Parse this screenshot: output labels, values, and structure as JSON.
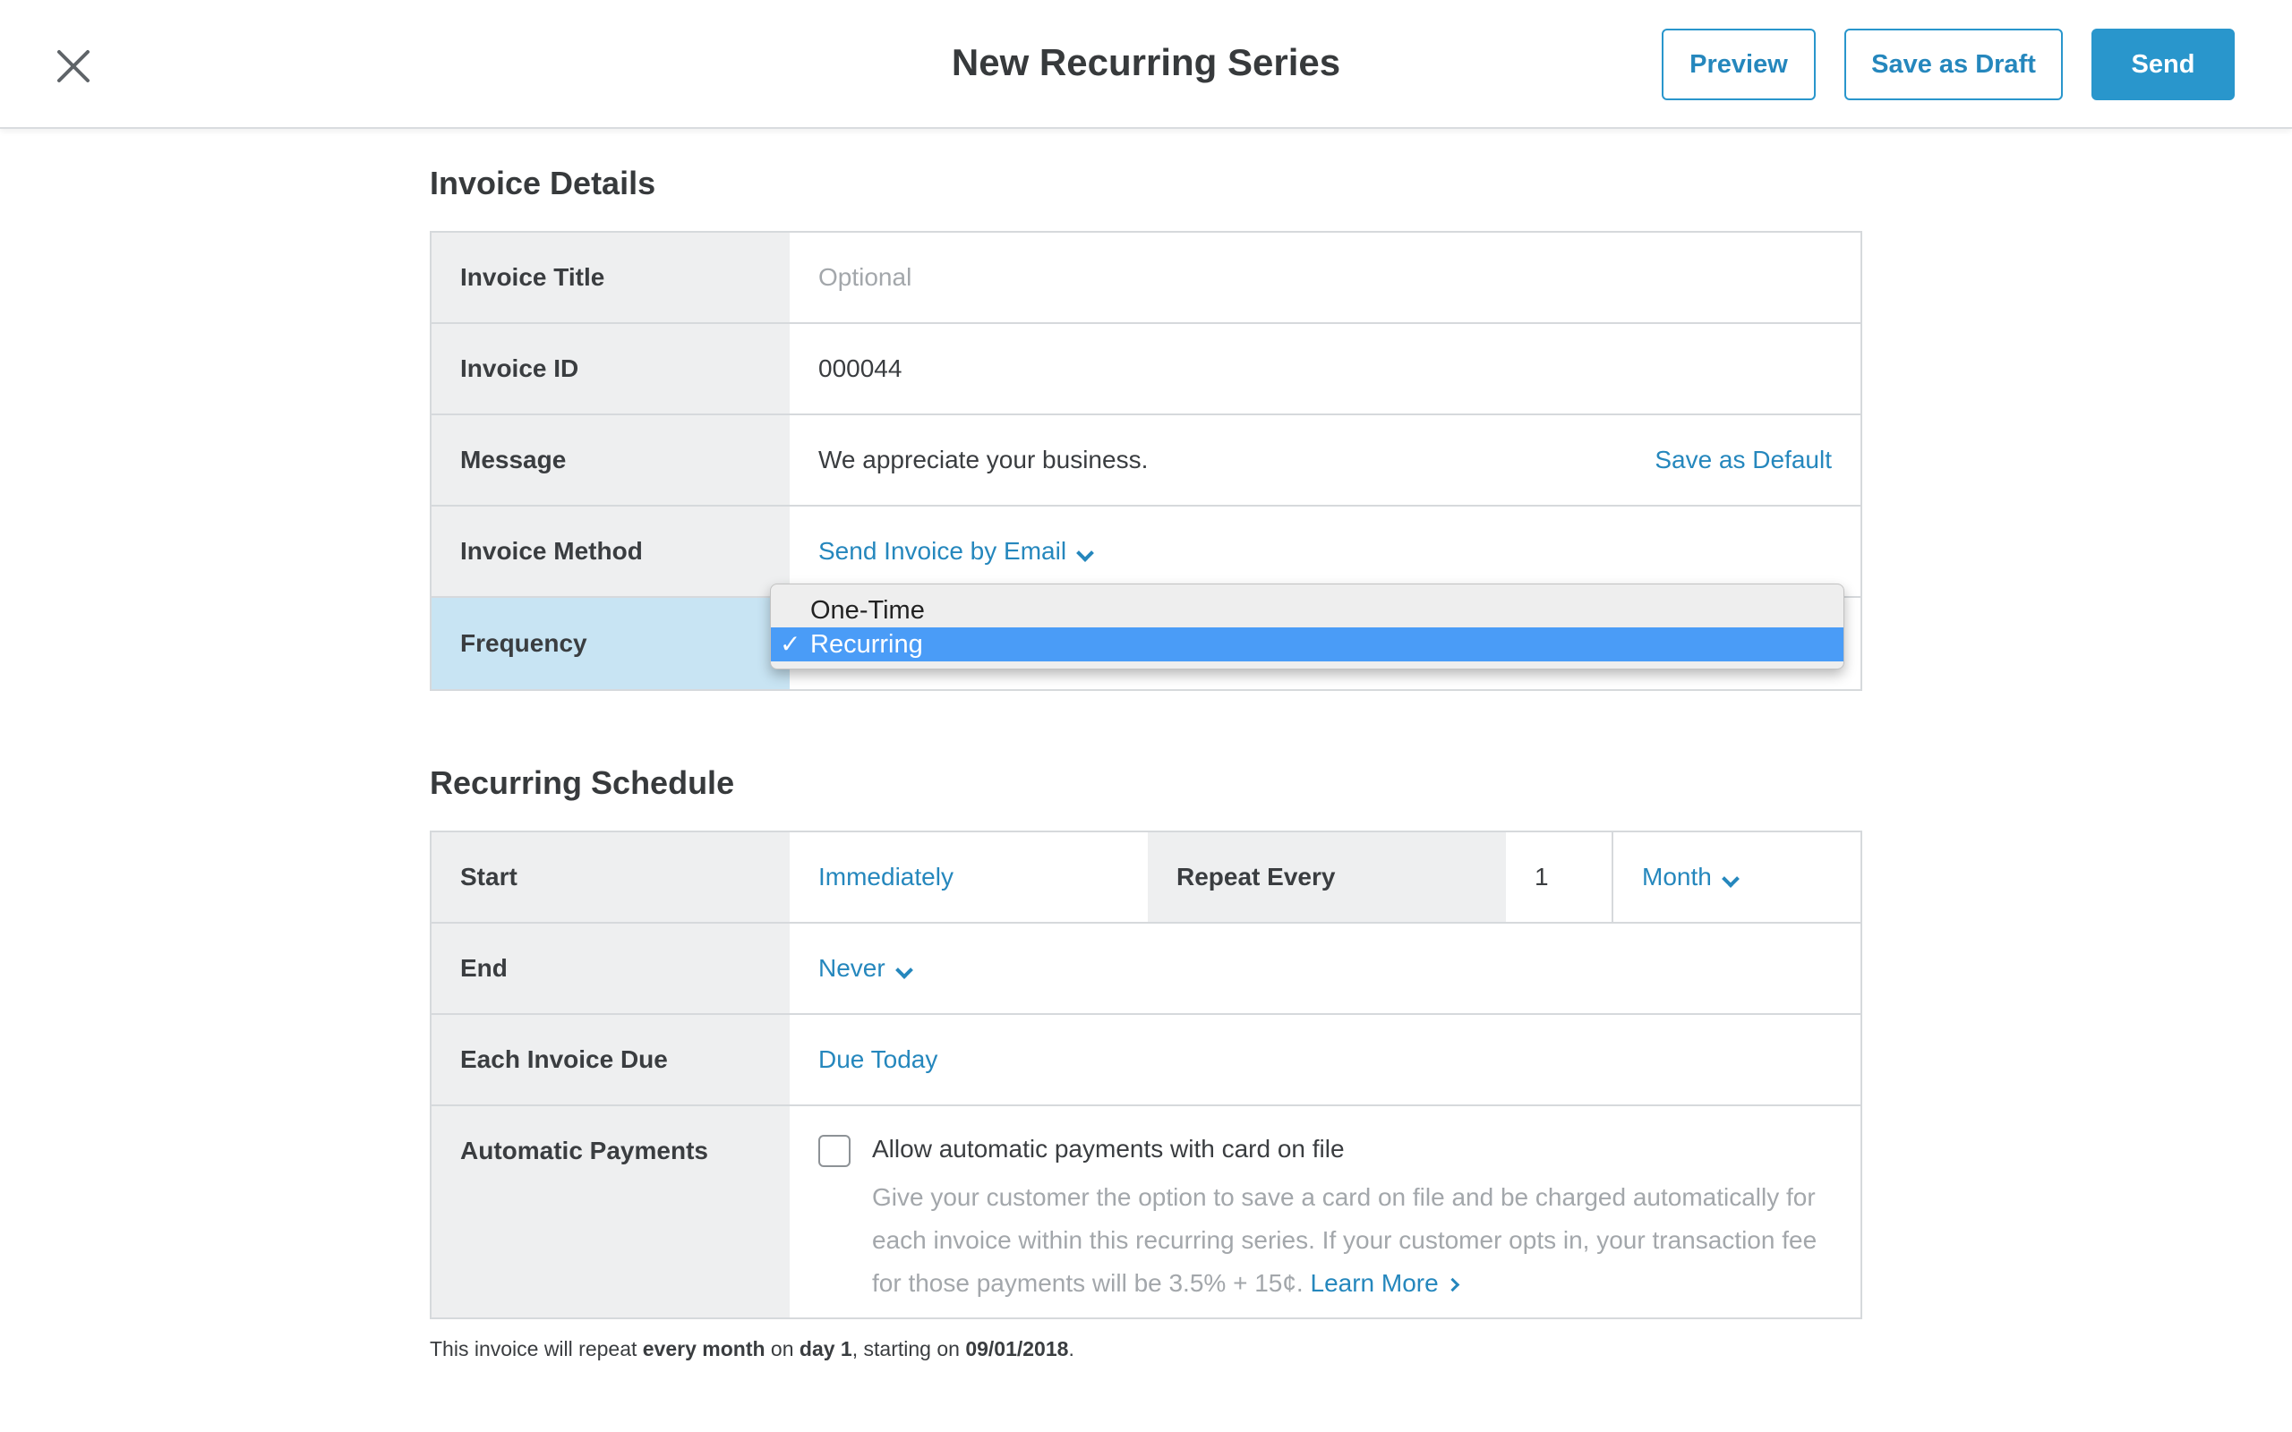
{
  "header": {
    "title": "New Recurring Series",
    "preview_label": "Preview",
    "draft_label": "Save as Draft",
    "send_label": "Send"
  },
  "invoice_details": {
    "heading": "Invoice Details",
    "rows": [
      {
        "label": "Invoice Title",
        "placeholder": "Optional"
      },
      {
        "label": "Invoice ID",
        "value": "000044"
      },
      {
        "label": "Message",
        "value": "We appreciate your business.",
        "action": "Save as Default"
      },
      {
        "label": "Invoice Method",
        "value": "Send Invoice by Email"
      },
      {
        "label": "Frequency"
      }
    ]
  },
  "frequency_dropdown": {
    "options": [
      "One-Time",
      "Recurring"
    ],
    "selected": "Recurring",
    "check": "✓"
  },
  "recurring_schedule": {
    "heading": "Recurring Schedule",
    "start_label": "Start",
    "start_value": "Immediately",
    "repeat_label": "Repeat Every",
    "repeat_count": "1",
    "repeat_unit": "Month",
    "end_label": "End",
    "end_value": "Never",
    "due_label": "Each Invoice Due",
    "due_value": "Due Today",
    "auto_label": "Automatic Payments",
    "auto_title": "Allow automatic payments with card on file",
    "auto_desc": "Give your customer the option to save a card on file and be charged automatically for each invoice within this recurring series. If your customer opts in, your transaction fee for those payments will be 3.5% + 15¢.",
    "learn_more": "Learn More"
  },
  "summary": {
    "prefix": "This invoice will repeat ",
    "interval": "every month",
    "mid": " on ",
    "day": "day 1",
    "mid2": ", starting on ",
    "date": "09/01/2018",
    "suffix": "."
  },
  "colors": {
    "accent": "#2996cc",
    "link": "#2587bd",
    "label_bg": "#eeeff0",
    "frequency_highlight": "#c8e4f3",
    "dropdown_selected": "#4a9cf7"
  }
}
